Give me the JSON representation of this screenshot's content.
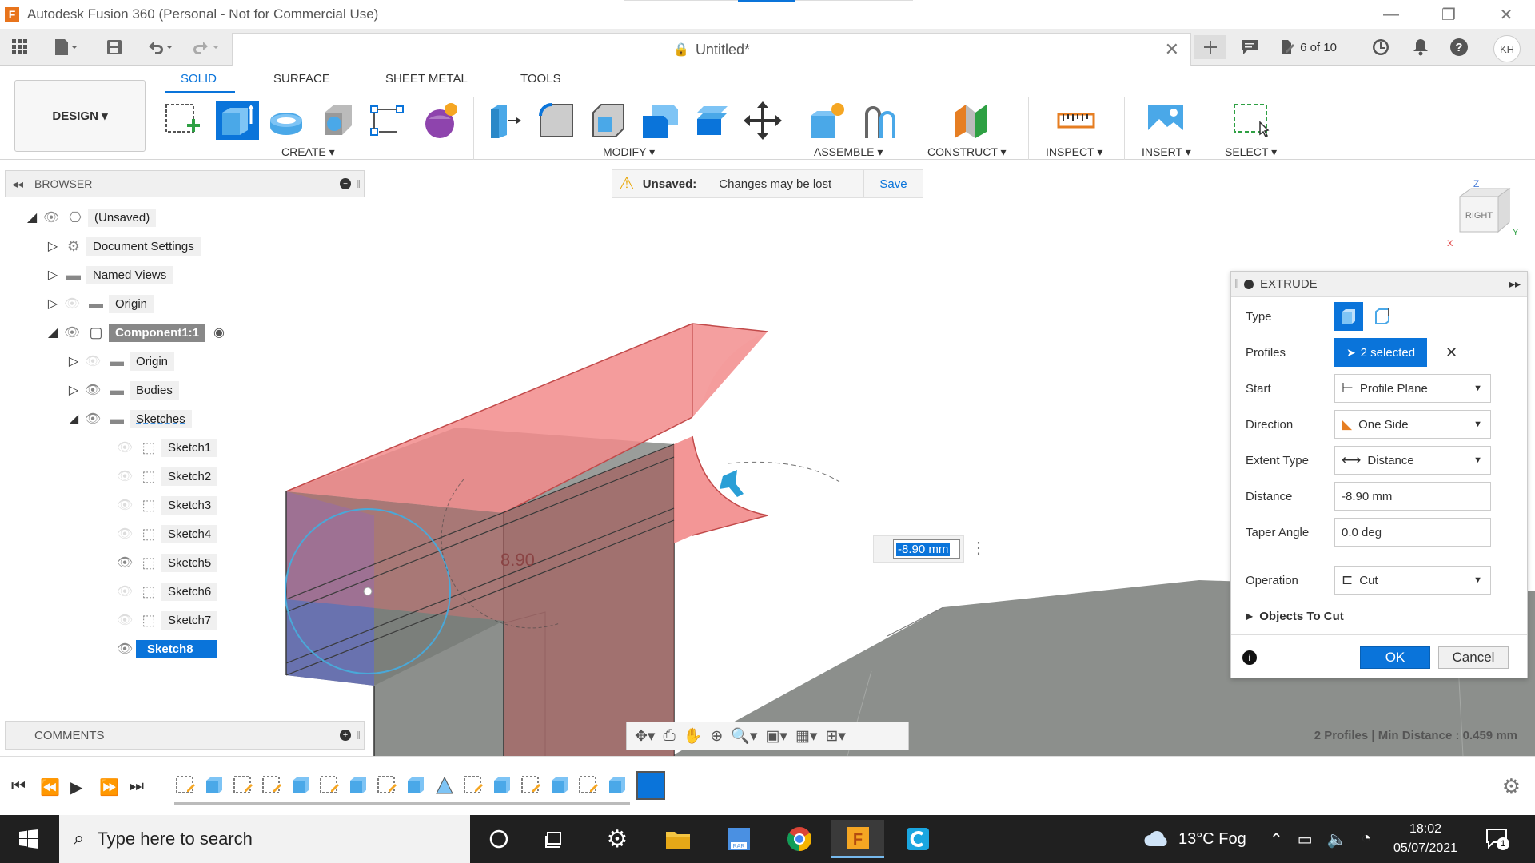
{
  "window": {
    "app_title": "Autodesk Fusion 360 (Personal - Not for Commercial Use)",
    "app_icon_letter": "F",
    "doc_title": "Untitled*",
    "job_status": "6 of 10",
    "user_initials": "KH"
  },
  "ribbon": {
    "workspace": "DESIGN ▾",
    "tabs": [
      "SOLID",
      "SURFACE",
      "SHEET METAL",
      "TOOLS"
    ],
    "active_tab": "SOLID",
    "groups": [
      "CREATE ▾",
      "MODIFY ▾",
      "ASSEMBLE ▾",
      "CONSTRUCT ▾",
      "INSPECT ▾",
      "INSERT ▾",
      "SELECT ▾"
    ]
  },
  "browser": {
    "title": "BROWSER",
    "root": "(Unsaved)",
    "items": [
      {
        "label": "Document Settings"
      },
      {
        "label": "Named Views"
      },
      {
        "label": "Origin"
      },
      {
        "label": "Component1:1"
      },
      {
        "label": "Origin"
      },
      {
        "label": "Bodies"
      },
      {
        "label": "Sketches"
      }
    ],
    "sketches": [
      "Sketch1",
      "Sketch2",
      "Sketch3",
      "Sketch4",
      "Sketch5",
      "Sketch6",
      "Sketch7",
      "Sketch8"
    ]
  },
  "unsaved_bar": {
    "label": "Unsaved:",
    "message": "Changes may be lost",
    "save": "Save"
  },
  "viewcube": {
    "face": "RIGHT",
    "axis_z": "Z",
    "axis_y": "Y",
    "axis_x": "X"
  },
  "canvas": {
    "dimension_label": "8.90",
    "distance_input": "-8.90 mm",
    "status": "2 Profiles | Min Distance : 0.459 mm"
  },
  "extrude": {
    "title": "EXTRUDE",
    "fields": {
      "type_label": "Type",
      "profiles_label": "Profiles",
      "profiles_value": "2 selected",
      "start_label": "Start",
      "start_value": "Profile Plane",
      "direction_label": "Direction",
      "direction_value": "One Side",
      "extent_label": "Extent Type",
      "extent_value": "Distance",
      "distance_label": "Distance",
      "distance_value": "-8.90 mm",
      "taper_label": "Taper Angle",
      "taper_value": "0.0 deg",
      "operation_label": "Operation",
      "operation_value": "Cut",
      "objects_to_cut": "Objects To Cut"
    },
    "ok": "OK",
    "cancel": "Cancel"
  },
  "comments": {
    "title": "COMMENTS"
  },
  "taskbar": {
    "search_placeholder": "Type here to search",
    "weather": "13°C  Fog",
    "time": "18:02",
    "date": "05/07/2021",
    "notifications": "1"
  },
  "colors": {
    "accent": "#0a74da",
    "extrude_preview": "#f28b8b",
    "body_gray": "#8c8f8c",
    "sketch_circle": "#4aa8d8"
  }
}
